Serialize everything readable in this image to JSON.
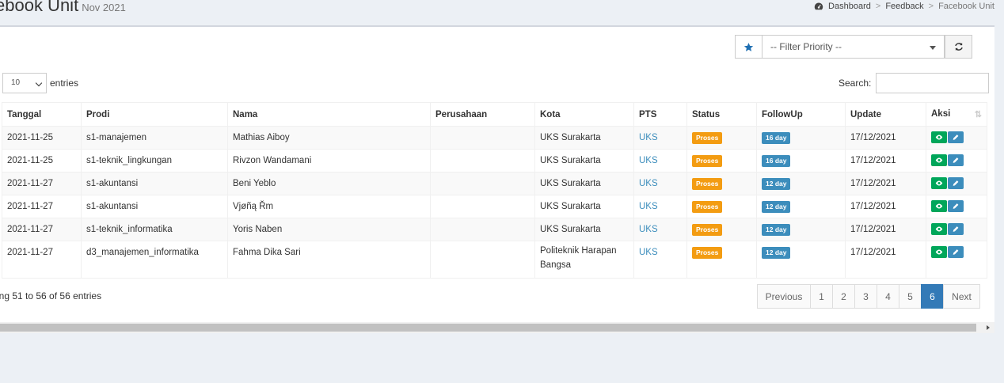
{
  "header": {
    "title": "ebook Unit",
    "subtitle": "Nov 2021"
  },
  "breadcrumb": {
    "items": [
      "Dashboard",
      "Feedback",
      "Facebook Unit"
    ],
    "separator": ">"
  },
  "filter": {
    "priority_placeholder": "-- Filter Priority --",
    "star_icon": "star-icon",
    "refresh_icon": "refresh-icon"
  },
  "length": {
    "value": "10",
    "label": "entries"
  },
  "search": {
    "label": "Search:",
    "value": ""
  },
  "table": {
    "columns": [
      "Tanggal",
      "Prodi",
      "Nama",
      "Perusahaan",
      "Kota",
      "PTS",
      "Status",
      "FollowUp",
      "Update",
      "Aksi"
    ],
    "rows": [
      {
        "tanggal": "2021-11-25",
        "prodi": "s1-manajemen",
        "nama": "Mathias Aiboy",
        "perusahaan": "",
        "kota": "UKS Surakarta",
        "pts": "UKS",
        "status": "Proses",
        "followup": "16 day",
        "update": "17/12/2021"
      },
      {
        "tanggal": "2021-11-25",
        "prodi": "s1-teknik_lingkungan",
        "nama": "Rivzon Wandamani",
        "perusahaan": "",
        "kota": "UKS Surakarta",
        "pts": "UKS",
        "status": "Proses",
        "followup": "16 day",
        "update": "17/12/2021"
      },
      {
        "tanggal": "2021-11-27",
        "prodi": "s1-akuntansi",
        "nama": "Beni Yeblo",
        "perusahaan": "",
        "kota": "UKS Surakarta",
        "pts": "UKS",
        "status": "Proses",
        "followup": "12 day",
        "update": "17/12/2021"
      },
      {
        "tanggal": "2021-11-27",
        "prodi": "s1-akuntansi",
        "nama": "Vjøñą Řm",
        "perusahaan": "",
        "kota": "UKS Surakarta",
        "pts": "UKS",
        "status": "Proses",
        "followup": "12 day",
        "update": "17/12/2021"
      },
      {
        "tanggal": "2021-11-27",
        "prodi": "s1-teknik_informatika",
        "nama": "Yoris Naben",
        "perusahaan": "",
        "kota": "UKS Surakarta",
        "pts": "UKS",
        "status": "Proses",
        "followup": "12 day",
        "update": "17/12/2021"
      },
      {
        "tanggal": "2021-11-27",
        "prodi": "d3_manajemen_informatika",
        "nama": "Fahma Dika Sari",
        "perusahaan": "",
        "kota": "Politeknik Harapan Bangsa",
        "pts": "UKS",
        "status": "Proses",
        "followup": "12 day",
        "update": "17/12/2021"
      }
    ]
  },
  "info": "ing 51 to 56 of 56 entries",
  "pagination": {
    "previous": "Previous",
    "next": "Next",
    "pages": [
      "1",
      "2",
      "3",
      "4",
      "5",
      "6"
    ],
    "active": "6"
  },
  "colors": {
    "status_proses": "#f39c12",
    "followup_badge": "#3c8dbc",
    "view_button": "#00a65a",
    "edit_button": "#3c8dbc",
    "link": "#3c8dbc",
    "page_active": "#337ab7"
  }
}
